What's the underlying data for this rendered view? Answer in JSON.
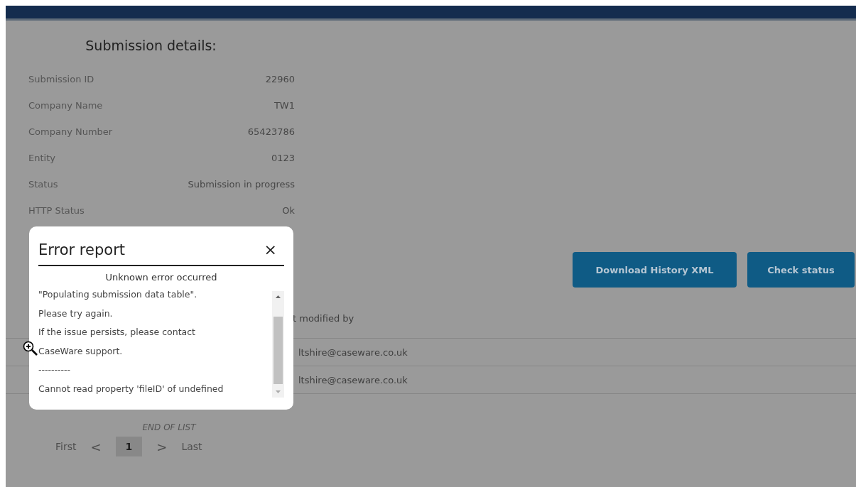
{
  "details": {
    "title": "Submission details:",
    "rows": [
      {
        "label": "Submission ID",
        "value": "22960"
      },
      {
        "label": "Company Name",
        "value": "TW1"
      },
      {
        "label": "Company Number",
        "value": "65423786"
      },
      {
        "label": "Entity",
        "value": "0123"
      },
      {
        "label": "Status",
        "value": "Submission in progress"
      },
      {
        "label": "HTTP Status",
        "value": "Ok"
      }
    ]
  },
  "buttons": [
    {
      "label": "Download History XML"
    },
    {
      "label": "Check status"
    }
  ],
  "table": {
    "columns": [
      "t modified by"
    ],
    "rows": [
      [
        "ltshire@caseware.co.uk"
      ],
      [
        "ltshire@caseware.co.uk"
      ]
    ]
  },
  "end_of_list": "END OF LIST",
  "pagination": {
    "first": "First",
    "prev": "<",
    "pages": [
      {
        "label": "1",
        "selected": true
      }
    ],
    "next": ">",
    "last": "Last"
  },
  "modal": {
    "title": "Error report",
    "close": "×",
    "heading": "Unknown error occurred",
    "lines": [
      "\"Populating submission data table\".",
      "Please try again.",
      "If the issue persists, please contact",
      "CaseWare support.",
      "----------",
      "Cannot read property 'fileID' of undefined"
    ]
  }
}
